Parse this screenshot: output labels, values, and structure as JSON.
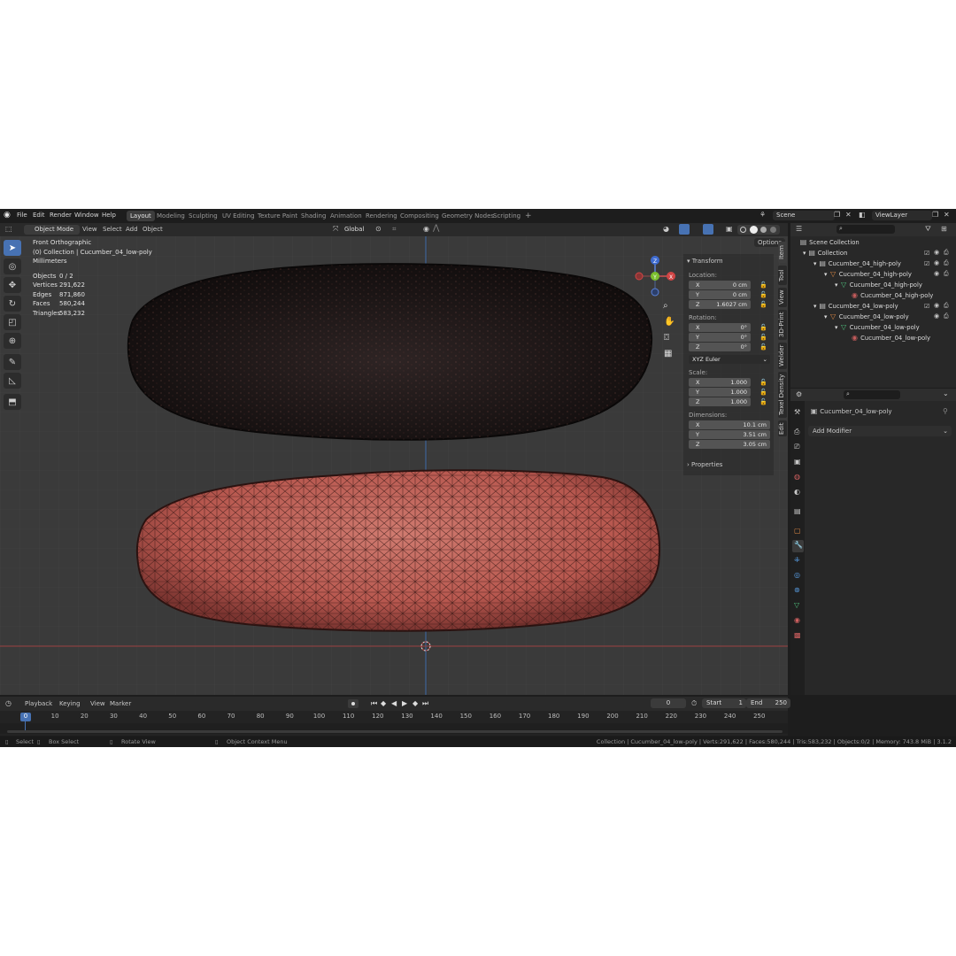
{
  "menubar": {
    "menus": [
      "File",
      "Edit",
      "Render",
      "Window",
      "Help"
    ],
    "workspaces": [
      "Layout",
      "Modeling",
      "Sculpting",
      "UV Editing",
      "Texture Paint",
      "Shading",
      "Animation",
      "Rendering",
      "Compositing",
      "Geometry Nodes",
      "Scripting"
    ],
    "active_workspace": "Layout",
    "add_tab": "+",
    "scene": "Scene",
    "view_layer": "ViewLayer"
  },
  "viewport_header": {
    "mode": "Object Mode",
    "menus": [
      "View",
      "Select",
      "Add",
      "Object"
    ],
    "orientation": "Global",
    "options": "Options"
  },
  "overlay": {
    "view_name": "Front Orthographic",
    "collection_line": "(0) Collection | Cucumber_04_low-poly",
    "units": "Millimeters",
    "stats": [
      {
        "label": "Objects",
        "value": "0 / 2"
      },
      {
        "label": "Vertices",
        "value": "291,622"
      },
      {
        "label": "Edges",
        "value": "871,860"
      },
      {
        "label": "Faces",
        "value": "580,244"
      },
      {
        "label": "Triangles",
        "value": "583,232"
      }
    ]
  },
  "gizmo": {
    "z": "Z",
    "y": "Y",
    "x": "X"
  },
  "npanel": {
    "transform_header": "Transform",
    "location_label": "Location:",
    "location": [
      {
        "axis": "X",
        "value": "0 cm"
      },
      {
        "axis": "Y",
        "value": "0 cm"
      },
      {
        "axis": "Z",
        "value": "1.6027 cm"
      }
    ],
    "rotation_label": "Rotation:",
    "rotation": [
      {
        "axis": "X",
        "value": "0°"
      },
      {
        "axis": "Y",
        "value": "0°"
      },
      {
        "axis": "Z",
        "value": "0°"
      }
    ],
    "rotation_mode": "XYZ Euler",
    "scale_label": "Scale:",
    "scale": [
      {
        "axis": "X",
        "value": "1.000"
      },
      {
        "axis": "Y",
        "value": "1.000"
      },
      {
        "axis": "Z",
        "value": "1.000"
      }
    ],
    "dimensions_label": "Dimensions:",
    "dimensions": [
      {
        "axis": "X",
        "value": "10.1 cm"
      },
      {
        "axis": "Y",
        "value": "3.51 cm"
      },
      {
        "axis": "Z",
        "value": "3.05 cm"
      }
    ],
    "properties_header": "Properties",
    "tabs": [
      "Item",
      "Tool",
      "View",
      "3D-Print",
      "Welder",
      "Texel Density",
      "Edit"
    ]
  },
  "outliner": {
    "rows": [
      {
        "label": "Scene Collection"
      },
      {
        "label": "Collection"
      },
      {
        "label": "Cucumber_04_high-poly"
      },
      {
        "label": "Cucumber_04_high-poly"
      },
      {
        "label": "Cucumber_04_high-poly"
      },
      {
        "label": "Cucumber_04_high-poly"
      },
      {
        "label": "Cucumber_04_low-poly"
      },
      {
        "label": "Cucumber_04_low-poly"
      },
      {
        "label": "Cucumber_04_low-poly"
      },
      {
        "label": "Cucumber_04_low-poly"
      }
    ]
  },
  "properties": {
    "object_name": "Cucumber_04_low-poly",
    "add_modifier": "Add Modifier"
  },
  "timeline": {
    "menus": [
      "Playback",
      "Keying",
      "View",
      "Marker"
    ],
    "current_frame": "0",
    "start_label": "Start",
    "start": "1",
    "end_label": "End",
    "end": "250",
    "ticks": [
      "0",
      "10",
      "20",
      "30",
      "40",
      "50",
      "60",
      "70",
      "80",
      "90",
      "100",
      "110",
      "120",
      "130",
      "140",
      "150",
      "160",
      "170",
      "180",
      "190",
      "200",
      "210",
      "220",
      "230",
      "240",
      "250"
    ]
  },
  "statusbar": {
    "select": "Select",
    "box_select": "Box Select",
    "rotate_view": "Rotate View",
    "context_menu": "Object Context Menu",
    "info": "Collection | Cucumber_04_low-poly | Verts:291,622 | Faces:580,244 | Tris:583,232 | Objects:0/2 | Memory: 743.8 MiB | 3.1.2"
  },
  "colors": {
    "accent": "#4772b3",
    "mesh_red": "#c0605a",
    "dark_mesh": "#1a1414"
  }
}
